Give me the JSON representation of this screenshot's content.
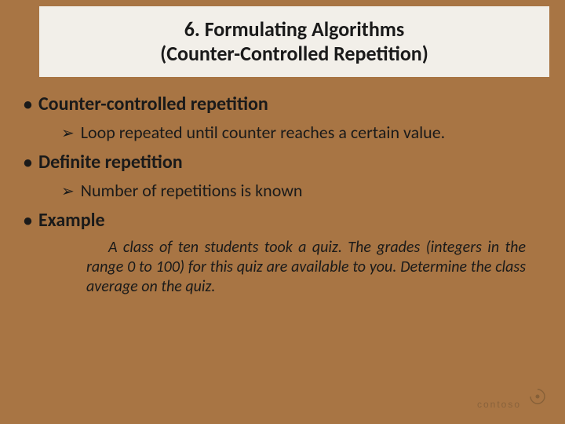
{
  "title": {
    "line1": "6.   Formulating Algorithms",
    "line2": "(Counter-Controlled Repetition)"
  },
  "bullets": [
    {
      "label": "Counter-controlled repetition",
      "subs": [
        "Loop repeated until counter reaches a certain value."
      ]
    },
    {
      "label": "Definite repetition",
      "subs": [
        "Number of repetitions is known"
      ]
    },
    {
      "label": "Example",
      "subs": []
    }
  ],
  "example_text": "A class of ten students took a quiz. The grades (integers in the range 0 to 100) for this quiz are available to you. Determine the class average on the quiz.",
  "logo_text": "contoso"
}
